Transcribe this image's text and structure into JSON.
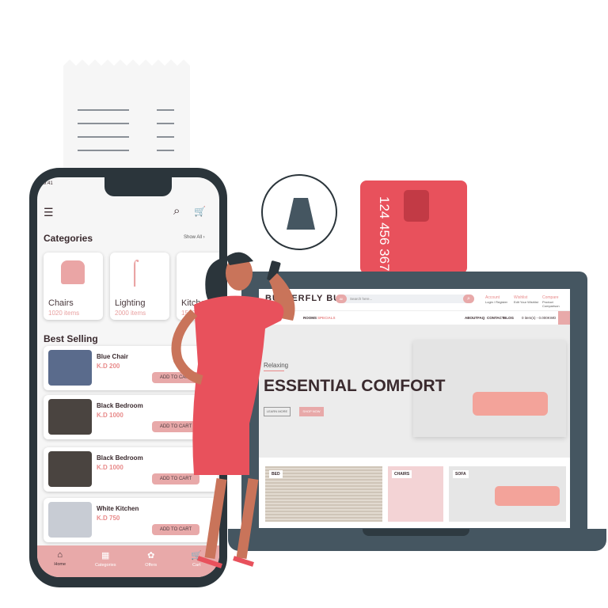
{
  "card": {
    "number": "124 456 367"
  },
  "phone": {
    "status_time": "9:41",
    "categories_title": "Categories",
    "show_all": "Show All",
    "categories": [
      {
        "name": "Chairs",
        "count": "1020 items"
      },
      {
        "name": "Lighting",
        "count": "2000 items"
      },
      {
        "name": "Kitchen",
        "count": "1500 items"
      }
    ],
    "best_selling_title": "Best Selling",
    "items": [
      {
        "name": "Blue Chair",
        "price": "K.D 200",
        "button": "ADD TO CART"
      },
      {
        "name": "Black Bedroom",
        "price": "K.D 1000",
        "button": "ADD TO CART"
      },
      {
        "name": "Black Bedroom",
        "price": "K.D 1000",
        "button": "ADD TO CART"
      },
      {
        "name": "White Kitchen",
        "price": "K.D 750",
        "button": "ADD TO CART"
      }
    ],
    "nav": [
      {
        "label": "Home"
      },
      {
        "label": "Categories"
      },
      {
        "label": "Offers"
      },
      {
        "label": "Cart"
      }
    ]
  },
  "site": {
    "logo": "BUTTERFLY BUG",
    "search_scope": "All",
    "search_placeholder": "Search here...",
    "account": {
      "title": "Account",
      "sub": "Login / Register"
    },
    "wishlist": {
      "title": "Wishlist",
      "sub": "Edit Your Wishlist"
    },
    "compare": {
      "title": "Compare",
      "sub": "Product Comparison"
    },
    "menu_left": [
      "ROOMS",
      "SPECIALS"
    ],
    "menu_right": [
      "ABOUT",
      "FAQ",
      "CONTACT",
      "BLOG"
    ],
    "cart_summary": "0 item(s) - 0.000KWD",
    "hero": {
      "kicker": "Relaxing",
      "title": "ESSENTIAL COMFORT",
      "learn_more": "LEARN MORE",
      "shop_now": "SHOP NOW"
    },
    "tiles": [
      "BED",
      "CHAIRS",
      "SOFA"
    ]
  }
}
